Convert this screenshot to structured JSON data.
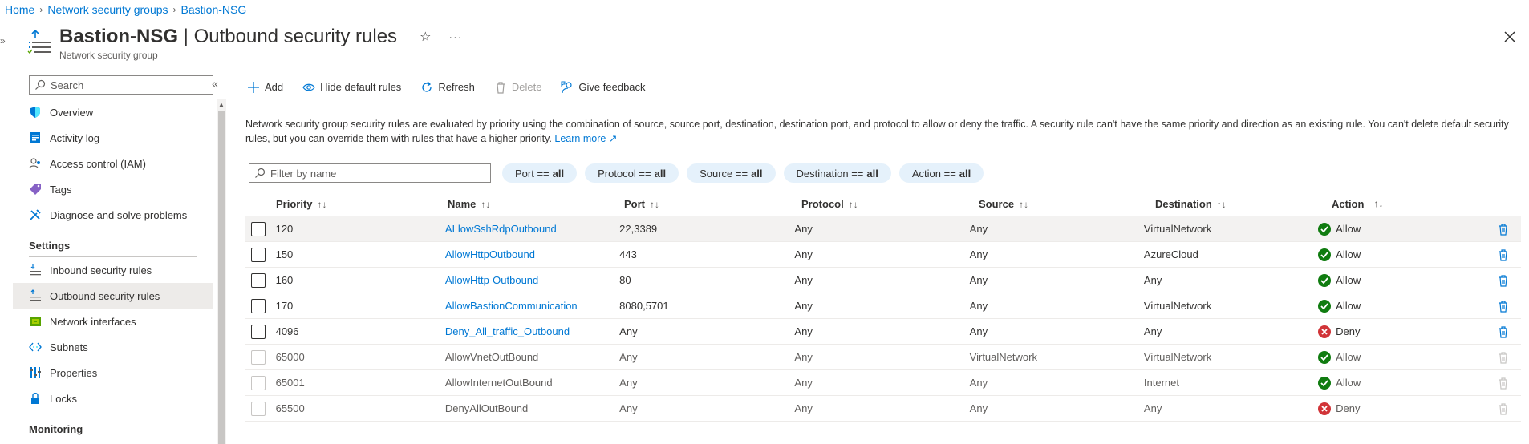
{
  "breadcrumb": [
    "Home",
    "Network security groups",
    "Bastion-NSG"
  ],
  "header": {
    "resource": "Bastion-NSG",
    "separator": " | ",
    "page": "Outbound security rules",
    "subtitle": "Network security group",
    "star_glyph": "☆",
    "more_glyph": "···"
  },
  "sidebar": {
    "search_placeholder": "Search",
    "collapse_glyph": "«",
    "items": [
      {
        "label": "Overview",
        "icon": "shield-icon"
      },
      {
        "label": "Activity log",
        "icon": "activity-log-icon"
      },
      {
        "label": "Access control (IAM)",
        "icon": "people-icon"
      },
      {
        "label": "Tags",
        "icon": "tag-icon"
      },
      {
        "label": "Diagnose and solve problems",
        "icon": "wrench-icon"
      }
    ],
    "settings_label": "Settings",
    "settings_items": [
      {
        "label": "Inbound security rules",
        "icon": "inbound-rules-icon"
      },
      {
        "label": "Outbound security rules",
        "icon": "outbound-rules-icon",
        "active": true
      },
      {
        "label": "Network interfaces",
        "icon": "network-interface-icon"
      },
      {
        "label": "Subnets",
        "icon": "subnet-icon"
      },
      {
        "label": "Properties",
        "icon": "properties-icon"
      },
      {
        "label": "Locks",
        "icon": "lock-icon"
      }
    ],
    "monitoring_label": "Monitoring"
  },
  "toolbar": {
    "add": "Add",
    "hide_default": "Hide default rules",
    "refresh": "Refresh",
    "delete": "Delete",
    "feedback": "Give feedback"
  },
  "description": {
    "text": "Network security group security rules are evaluated by priority using the combination of source, source port, destination, destination port, and protocol to allow or deny the traffic. A security rule can't have the same priority and direction as an existing rule. You can't delete default security rules, but you can override them with rules that have a higher priority.",
    "learn_more": "Learn more"
  },
  "filters": {
    "placeholder": "Filter by name",
    "pills": [
      {
        "label": "Port ==",
        "value": "all"
      },
      {
        "label": "Protocol ==",
        "value": "all"
      },
      {
        "label": "Source ==",
        "value": "all"
      },
      {
        "label": "Destination ==",
        "value": "all"
      },
      {
        "label": "Action ==",
        "value": "all"
      }
    ]
  },
  "table": {
    "columns": [
      "Priority",
      "Name",
      "Port",
      "Protocol",
      "Source",
      "Destination",
      "Action"
    ],
    "sort_glyph": "↑↓",
    "rows": [
      {
        "priority": "120",
        "name": "ALlowSshRdpOutbound",
        "port": "22,3389",
        "protocol": "Any",
        "source": "Any",
        "destination": "VirtualNetwork",
        "action": "Allow",
        "default": false
      },
      {
        "priority": "150",
        "name": "AllowHttpOutbound",
        "port": "443",
        "protocol": "Any",
        "source": "Any",
        "destination": "AzureCloud",
        "action": "Allow",
        "default": false
      },
      {
        "priority": "160",
        "name": "AllowHttp-Outbound",
        "port": "80",
        "protocol": "Any",
        "source": "Any",
        "destination": "Any",
        "action": "Allow",
        "default": false
      },
      {
        "priority": "170",
        "name": "AllowBastionCommunication",
        "port": "8080,5701",
        "protocol": "Any",
        "source": "Any",
        "destination": "VirtualNetwork",
        "action": "Allow",
        "default": false
      },
      {
        "priority": "4096",
        "name": "Deny_All_traffic_Outbound",
        "port": "Any",
        "protocol": "Any",
        "source": "Any",
        "destination": "Any",
        "action": "Deny",
        "default": false
      },
      {
        "priority": "65000",
        "name": "AllowVnetOutBound",
        "port": "Any",
        "protocol": "Any",
        "source": "VirtualNetwork",
        "destination": "VirtualNetwork",
        "action": "Allow",
        "default": true
      },
      {
        "priority": "65001",
        "name": "AllowInternetOutBound",
        "port": "Any",
        "protocol": "Any",
        "source": "Any",
        "destination": "Internet",
        "action": "Allow",
        "default": true
      },
      {
        "priority": "65500",
        "name": "DenyAllOutBound",
        "port": "Any",
        "protocol": "Any",
        "source": "Any",
        "destination": "Any",
        "action": "Deny",
        "default": true
      }
    ]
  },
  "colors": {
    "accent": "#0078d4",
    "allow": "#107c10",
    "deny": "#d13438"
  }
}
